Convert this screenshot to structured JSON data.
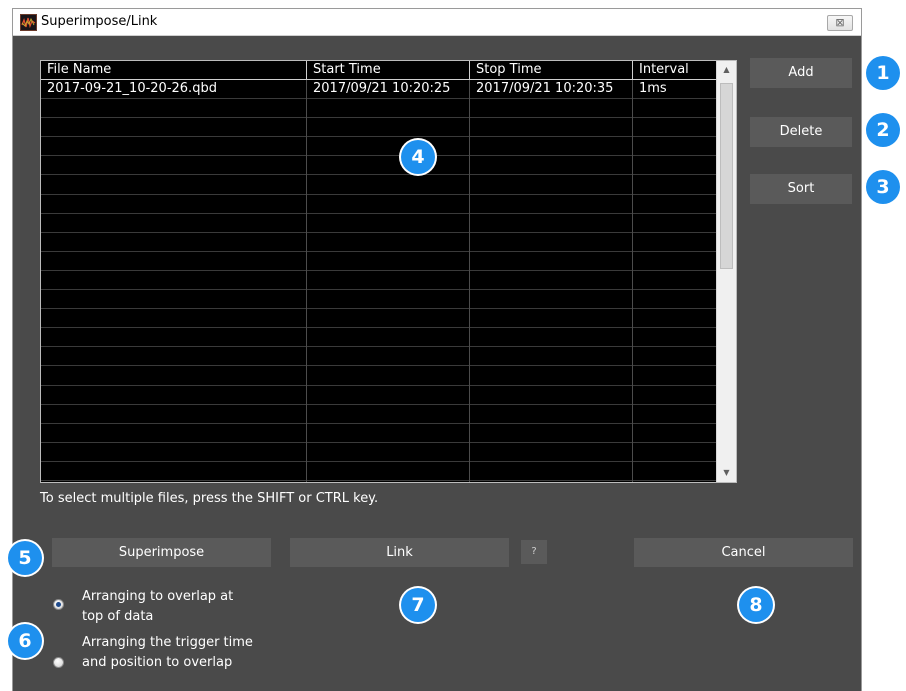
{
  "window": {
    "title": "Superimpose/Link",
    "close_glyph": "⊠"
  },
  "table": {
    "columns": [
      "File Name",
      "Start Time",
      "Stop Time",
      "Interval"
    ],
    "rows": [
      [
        "2017-09-21_10-20-26.qbd",
        "2017/09/21 10:20:25",
        "2017/09/21 10:20:35",
        "1ms"
      ]
    ]
  },
  "buttons": {
    "add": "Add",
    "delete": "Delete",
    "sort": "Sort",
    "superimpose": "Superimpose",
    "link": "Link",
    "help": "?",
    "cancel": "Cancel"
  },
  "hint": "To select multiple files, press the SHIFT or CTRL key.",
  "options": {
    "overlap_top_line1": "Arranging to overlap at",
    "overlap_top_line2": "top of data",
    "trigger_line1": "Arranging the trigger time",
    "trigger_line2": "and position to overlap",
    "selected": "overlap_top"
  },
  "badges": {
    "b1": "1",
    "b2": "2",
    "b3": "3",
    "b4": "4",
    "b5": "5",
    "b6": "6",
    "b7": "7",
    "b8": "8"
  },
  "icons": {
    "app": "app-waveform-icon",
    "scroll_up": "scroll-up-arrow-icon",
    "scroll_down": "scroll-down-arrow-icon"
  },
  "colors": {
    "window_bg": "#4a4a4a",
    "button_bg": "#5a5a5a",
    "table_bg": "#000000",
    "badge": "#1e90ee"
  }
}
